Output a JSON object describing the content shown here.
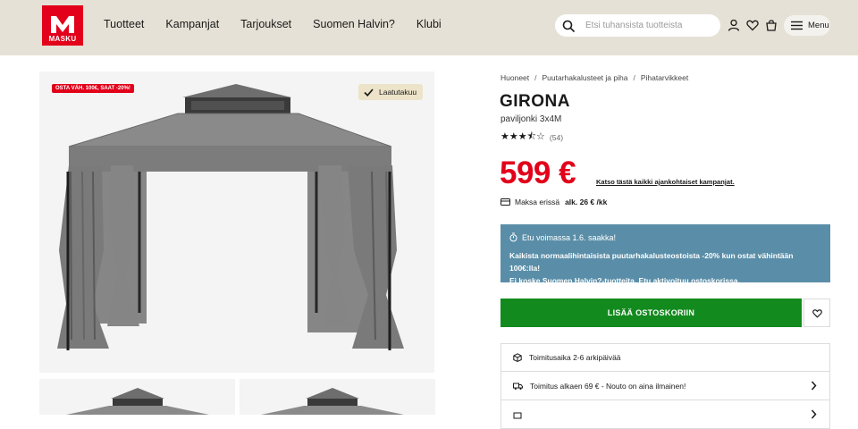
{
  "brand": {
    "name": "MASKU",
    "color": "#e2001a"
  },
  "nav": {
    "items": [
      "Tuotteet",
      "Kampanjat",
      "Tarjoukset",
      "Suomen Halvin?",
      "Klubi"
    ]
  },
  "search": {
    "placeholder": "Etsi tuhansista tuotteista",
    "icon": "search-icon"
  },
  "header_icons": [
    "user-icon",
    "heart-icon",
    "cart-icon"
  ],
  "menu": {
    "label": "Menu",
    "icon": "hamburger-icon"
  },
  "gallery": {
    "promo_badge": "OSTA VÄH. 100€, SAAT -20%!",
    "quality_badge": "Laatutakuu"
  },
  "breadcrumb": [
    "Huoneet",
    "Puutarhakalusteet ja piha",
    "Pihatarvikkeet"
  ],
  "product": {
    "title": "GIRONA",
    "subtitle": "paviljonki 3x4M",
    "rating": 3.5,
    "rating_count": "(54)",
    "price": "599 €",
    "price_color": "#e2001a",
    "campaign_link": "Katso tästä kaikki ajankohtaiset kampanjat.",
    "installment_label": "Maksa erissä",
    "installment_amount": "alk. 26 € /kk"
  },
  "promo": {
    "header": "Etu voimassa 1.6. saakka!",
    "line1": "Kaikista normaalihintaisista puutarhakalusteostoista -20% kun ostat vähintään 100€:lla!",
    "line2": "Ei koske Suomen Halvin?-tuotteita. Etu aktivoituu ostoskorissa.",
    "background": "#5a8ea8"
  },
  "add_to_cart": {
    "label": "LISÄÄ OSTOSKORIIN",
    "color": "#138a1e"
  },
  "info": {
    "delivery_time": "Toimitusaika 2-6 arkipäivää",
    "shipping": "Toimitus alkaen 69 € - Nouto on aina ilmainen!"
  }
}
